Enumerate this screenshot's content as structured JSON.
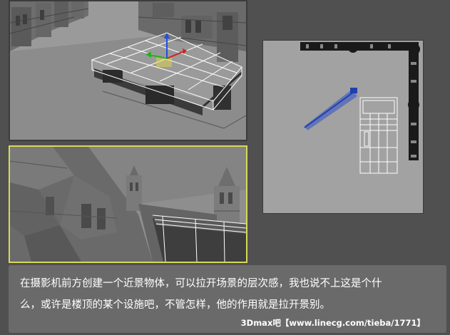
{
  "caption": {
    "line1": "在摄影机前方创建一个近景物体，可以拉开场景的层次感，我也说不上这是个什",
    "line2": "么，或许是楼顶的某个设施吧，不管怎样，他的作用就是拉开景别。",
    "credit": "3Dmax吧【www.linecg.com/tieba/1771】"
  },
  "colors": {
    "background": "#505050",
    "active_viewport_border": "#d8d85a",
    "caption_bg": "#6a6a6a",
    "wire_white": "#ffffff",
    "gizmo_x": "#d02020",
    "gizmo_y": "#20b020",
    "gizmo_z": "#2050e0",
    "camera_blue": "#3050c8"
  }
}
